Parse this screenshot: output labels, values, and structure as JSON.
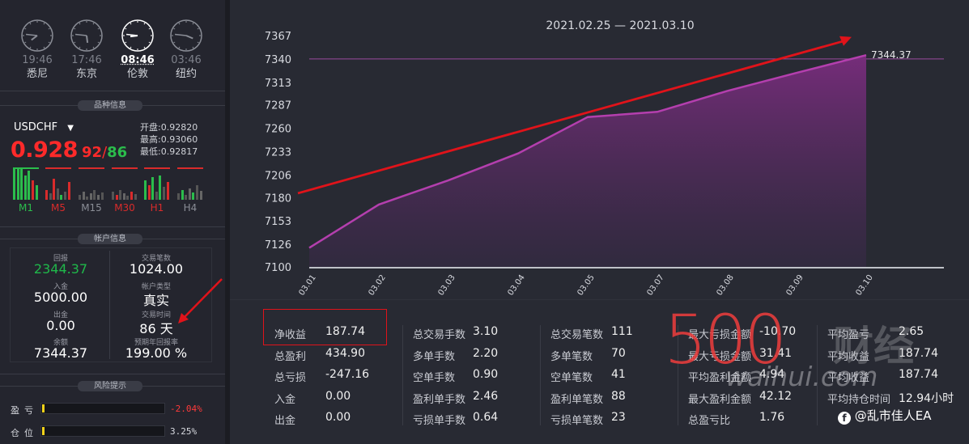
{
  "clocks": [
    {
      "time": "19:46",
      "city": "悉尼",
      "active": false
    },
    {
      "time": "17:46",
      "city": "东京",
      "active": false
    },
    {
      "time": "08:46",
      "city": "伦敦",
      "active": true
    },
    {
      "time": "03:46",
      "city": "纽约",
      "active": false
    }
  ],
  "symbol_section": {
    "title": "品种信息",
    "symbol": "USDCHF",
    "price_main": "0.928",
    "price_bid": "92",
    "price_sep": "/",
    "price_ask": "86",
    "open_label": "开盘:",
    "open_value": "0.92820",
    "high_label": "最高:",
    "high_value": "0.93060",
    "low_label": "最低:",
    "low_value": "0.92817",
    "timeframes": [
      "M1",
      "M5",
      "M15",
      "M30",
      "H1",
      "H4"
    ]
  },
  "account_section": {
    "title": "帐户信息",
    "return_label": "回报",
    "return_value": "2344.37",
    "trades_label": "交易笔数",
    "trades_value": "1024.00",
    "deposit_label": "入金",
    "deposit_value": "5000.00",
    "type_label": "帐户类型",
    "type_value": "真实",
    "withdraw_label": "出金",
    "withdraw_value": "0.00",
    "time_label": "交易时间",
    "time_value": "86 天",
    "balance_label": "余额",
    "balance_value": "7344.37",
    "annual_label": "预期年回报率",
    "annual_value": "199.00 %"
  },
  "risk_section": {
    "title": "风险提示",
    "profit_label": "盈亏",
    "profit_value": "-2.04%",
    "position_label": "仓位",
    "position_value": "3.25%",
    "profit_fraction": 0.02,
    "position_fraction": 0.02
  },
  "chart_data": {
    "type": "area",
    "title": "2021.02.25 — 2021.03.10",
    "x": [
      "03.01",
      "03.02",
      "03.03",
      "03.04",
      "03.05",
      "03.07",
      "03.08",
      "03.09",
      "03.10"
    ],
    "values": [
      7122,
      7172,
      7200,
      7231,
      7273,
      7279,
      7303,
      7324,
      7344.37
    ],
    "ylim": [
      7100,
      7367
    ],
    "yticks": [
      7100,
      7126,
      7153,
      7180,
      7206,
      7233,
      7260,
      7287,
      7313,
      7340,
      7367
    ],
    "reference_line": 7340,
    "end_label": "7344.37",
    "series_color": "#b43fae",
    "trend_arrow_start": 7185,
    "trend_arrow_end": 7370,
    "trend_color": "#e0131a"
  },
  "stats": {
    "col1": [
      {
        "label": "净收益",
        "value": "187.74"
      },
      {
        "label": "总盈利",
        "value": "434.90"
      },
      {
        "label": "总亏损",
        "value": "-247.16"
      },
      {
        "label": "入金",
        "value": "0.00"
      },
      {
        "label": "出金",
        "value": "0.00"
      }
    ],
    "col2": [
      {
        "label": "总交易手数",
        "value": "3.10"
      },
      {
        "label": "多单手数",
        "value": "2.20"
      },
      {
        "label": "空单手数",
        "value": "0.90"
      },
      {
        "label": "盈利单手数",
        "value": "2.46"
      },
      {
        "label": "亏损单手数",
        "value": "0.64"
      }
    ],
    "col3": [
      {
        "label": "总交易笔数",
        "value": "111"
      },
      {
        "label": "多单笔数",
        "value": "70"
      },
      {
        "label": "空单笔数",
        "value": "41"
      },
      {
        "label": "盈利单笔数",
        "value": "88"
      },
      {
        "label": "亏损单笔数",
        "value": "23"
      }
    ],
    "col4": [
      {
        "label": "最大亏损金额",
        "value": "-10.70"
      },
      {
        "label": "最大亏损金额",
        "value": "31.41"
      },
      {
        "label": "平均盈利金额",
        "value": "4.94"
      },
      {
        "label": "最大盈利金额",
        "value": "42.12"
      },
      {
        "label": "总盈亏比",
        "value": "1.76"
      }
    ],
    "col5": [
      {
        "label": "平均盈亏",
        "value": "2.65"
      },
      {
        "label": "平均收益",
        "value": "187.74"
      },
      {
        "label": "平均收益",
        "value": "187.74"
      },
      {
        "label": "平均持仓时间",
        "value": "12.94小时"
      }
    ]
  },
  "watermark": {
    "big": "500",
    "cn": "财经",
    "url": "waihui.com",
    "credit": "@乱市佳人EA"
  }
}
